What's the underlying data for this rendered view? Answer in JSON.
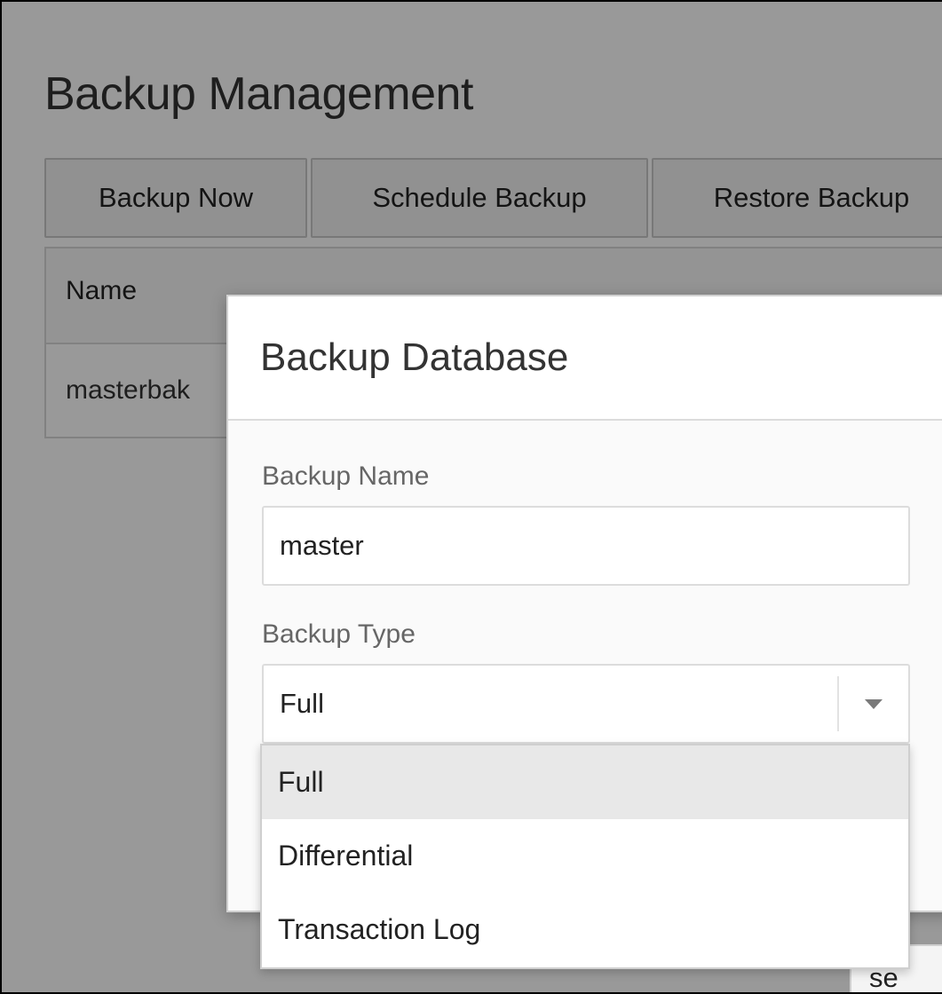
{
  "page": {
    "title": "Backup Management"
  },
  "toolbar": {
    "buttons": [
      {
        "label": "Backup Now"
      },
      {
        "label": "Schedule Backup"
      },
      {
        "label": "Restore Backup"
      }
    ]
  },
  "table": {
    "headers": [
      "Name"
    ],
    "rows": [
      [
        "masterbak"
      ]
    ]
  },
  "dialog": {
    "title": "Backup Database",
    "backup_name_label": "Backup Name",
    "backup_name_value": "master",
    "backup_type_label": "Backup Type",
    "backup_type_value": "Full",
    "footer_button_partial": "se"
  },
  "dropdown": {
    "options": [
      {
        "label": "Full",
        "selected": true
      },
      {
        "label": "Differential",
        "selected": false
      },
      {
        "label": "Transaction Log",
        "selected": false
      }
    ]
  },
  "colors": {
    "overlay": "#000000",
    "selected_option_bg": "#e8e8e8"
  }
}
